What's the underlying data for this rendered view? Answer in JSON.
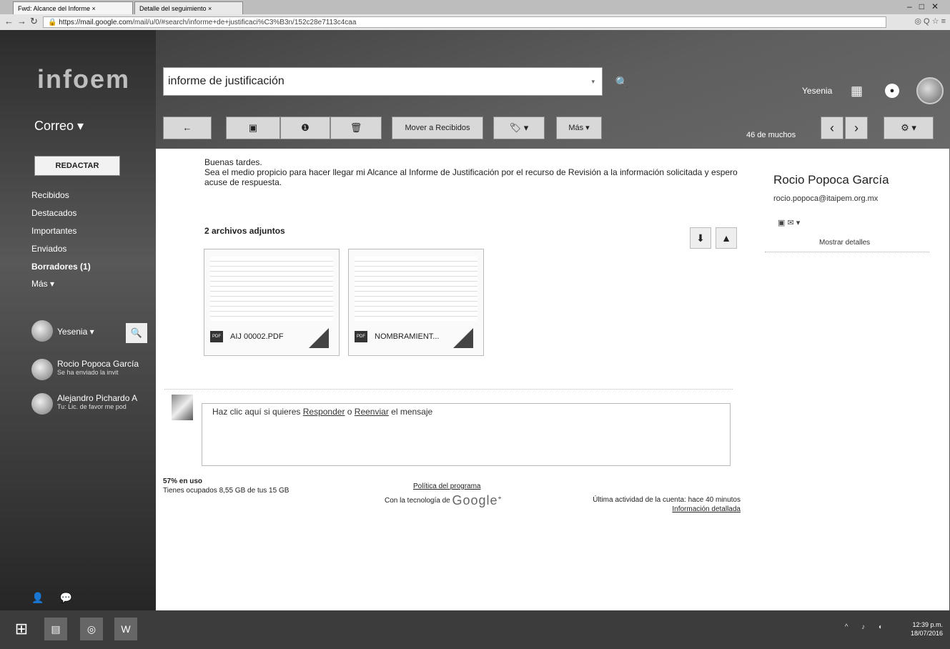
{
  "browser": {
    "tabs": [
      "Fwd: Alcance del Informe ×",
      "Detalle del seguimiento ×"
    ],
    "window_controls": [
      "–",
      "□",
      "✕"
    ],
    "url_domain": "https://mail.google.com",
    "url_path": "/mail/u/0/#search/informe+de+justificaci%C3%B3n/152c28e7113c4caa",
    "addr_icons": "◎ Q ☆ ≡"
  },
  "header": {
    "logo": "infoem",
    "search_value": "informe de justificación",
    "user_name": "Yesenia"
  },
  "toolbar": {
    "back": "←",
    "archive": "▣",
    "spam": "❶",
    "delete": "🗑",
    "move_to": "Mover a Recibidos",
    "labels": "🏷 ▾",
    "more": "Más ▾",
    "pager_text": "46 de muchos",
    "prev": "‹",
    "next": "›",
    "settings": "⚙ ▾"
  },
  "sidebar": {
    "app_label": "Correo ▾",
    "compose": "REDACTAR",
    "items": [
      {
        "label": "Recibidos"
      },
      {
        "label": "Destacados"
      },
      {
        "label": "Importantes"
      },
      {
        "label": "Enviados"
      },
      {
        "label": "Borradores (1)"
      },
      {
        "label": "Más ▾"
      }
    ],
    "chat_user": "Yesenia ▾",
    "contacts": [
      {
        "name": "Rocio Popoca García",
        "status": "Se ha enviado la invit"
      },
      {
        "name": "Alejandro Pichardo A",
        "status": "Tu: Lic. de favor me pod"
      }
    ]
  },
  "message": {
    "greeting": "Buenas tardes.",
    "body": "Sea el medio propicio para hacer llegar mi Alcance al Informe de Justificación por el recurso de Revisión a la información solicitada y espero acuse de respuesta.",
    "attachments_title": "2 archivos adjuntos",
    "attachments": [
      {
        "name": "AIJ 00002.PDF",
        "type": "PDF"
      },
      {
        "name": "NOMBRAMIENT...",
        "type": "PDF"
      }
    ],
    "reply_prompt_pre": "Haz clic aquí si quieres ",
    "reply_link": "Responder",
    "reply_mid": " o ",
    "forward_link": "Reenviar",
    "reply_post": " el mensaje"
  },
  "sender": {
    "name": "Rocio Popoca García",
    "email": "rocio.popoca@itaipem.org.mx",
    "icons": "▣ ✉ ▾",
    "details": "Mostrar detalles"
  },
  "footer": {
    "usage": "57% en uso",
    "storage": "Tienes ocupados 8,55 GB de tus 15 GB",
    "policy": "Política del programa",
    "powered": "Con la tecnología de",
    "google": "Google",
    "plus": "+",
    "last_activity": "Última actividad de la cuenta: hace 40 minutos",
    "details": "Información detallada"
  },
  "taskbar": {
    "icons": [
      "⊞",
      "▤",
      "◎",
      "W"
    ],
    "tray": "^ ♪ ◐",
    "time": "12:39 p.m.",
    "date": "18/07/2016"
  }
}
